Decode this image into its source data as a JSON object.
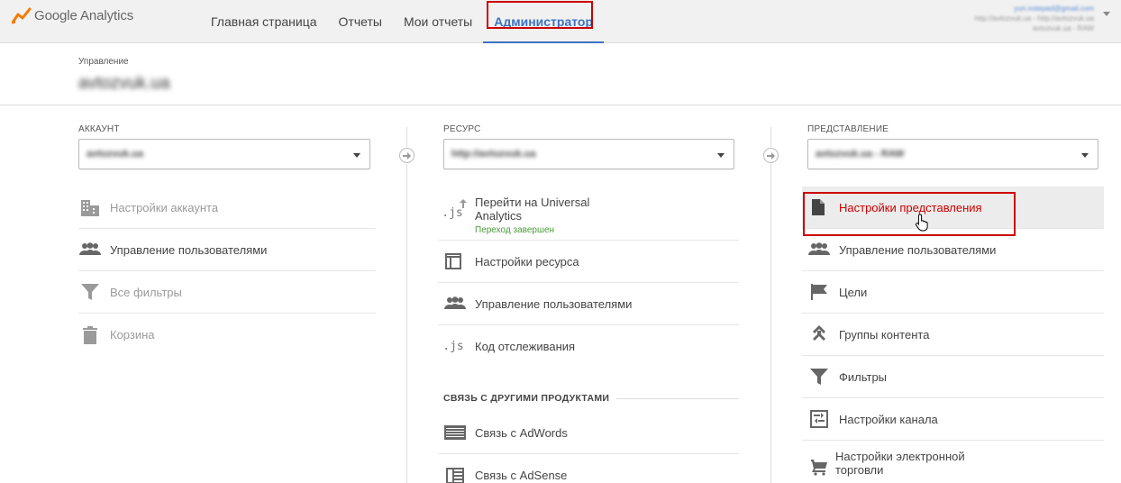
{
  "header": {
    "app_name": "Google Analytics",
    "nav": [
      {
        "label": "Главная страница"
      },
      {
        "label": "Отчеты"
      },
      {
        "label": "Мои отчеты"
      },
      {
        "label": "Администратор",
        "active": true
      }
    ],
    "account_email": "yuri.notepad@gmail.com",
    "account_line2": "http://avtozvuk.ua - http://avtozvuk.ua",
    "account_line3": "avtozvuk.ua - RAW"
  },
  "management": {
    "label": "Управление",
    "name": "avtozvuk.ua"
  },
  "account_column": {
    "label": "АККАУНТ",
    "selected": "avtozvuk.ua",
    "items": [
      {
        "label": "Настройки аккаунта",
        "icon": "building-icon",
        "disabled": true
      },
      {
        "label": "Управление пользователями",
        "icon": "users-icon",
        "disabled": false
      },
      {
        "label": "Все фильтры",
        "icon": "filter-icon",
        "disabled": true
      },
      {
        "label": "Корзина",
        "icon": "trash-icon",
        "disabled": true
      }
    ]
  },
  "property_column": {
    "label": "РЕСУРС",
    "selected": "http://avtozvuk.ua",
    "items": [
      {
        "label": "Перейти на Universal Analytics",
        "sub": "Переход завершен",
        "icon": "js-upgrade-icon"
      },
      {
        "label": "Настройки ресурса",
        "icon": "layout-icon"
      },
      {
        "label": "Управление пользователями",
        "icon": "users-icon"
      },
      {
        "label": "Код отслеживания",
        "icon": "js-icon"
      }
    ],
    "section_title": "СВЯЗЬ С ДРУГИМИ ПРОДУКТАМИ",
    "links": [
      {
        "label": "Связь с AdWords",
        "icon": "adwords-icon"
      },
      {
        "label": "Связь с AdSense",
        "icon": "adsense-icon"
      }
    ]
  },
  "view_column": {
    "label": "ПРЕДСТАВЛЕНИЕ",
    "selected": "avtozvuk.ua - RAW",
    "items": [
      {
        "label": "Настройки представления",
        "icon": "document-icon",
        "selected": true
      },
      {
        "label": "Управление пользователями",
        "icon": "users-icon"
      },
      {
        "label": "Цели",
        "icon": "flag-icon"
      },
      {
        "label": "Группы контента",
        "icon": "content-groups-icon"
      },
      {
        "label": "Фильтры",
        "icon": "filter-icon"
      },
      {
        "label": "Настройки канала",
        "icon": "channel-settings-icon"
      },
      {
        "label": "Настройки электронной торговли",
        "icon": "cart-icon"
      }
    ]
  },
  "colors": {
    "accent": "#3d72c4",
    "highlight": "#cc0000",
    "selected_text": "#cc0000",
    "success": "#4a9a3a"
  }
}
